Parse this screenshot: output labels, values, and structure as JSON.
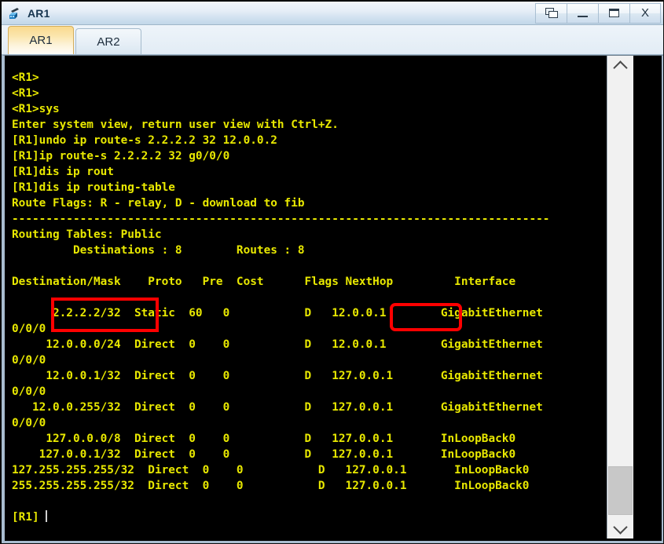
{
  "window": {
    "title": "AR1",
    "icon": "router-icon",
    "controls": [
      {
        "name": "restore-button",
        "icon": "restore-icon",
        "label": ""
      },
      {
        "name": "minimize-button",
        "icon": "minimize-icon",
        "label": ""
      },
      {
        "name": "maximize-button",
        "icon": "maximize-icon",
        "label": ""
      },
      {
        "name": "close-button",
        "icon": "close-icon",
        "label": "X"
      }
    ]
  },
  "tabs": [
    {
      "label": "AR1",
      "active": true
    },
    {
      "label": "AR2",
      "active": false
    }
  ],
  "terminal": {
    "colors": {
      "background": "#000000",
      "foreground": "#e8e800",
      "annotation": "#ff0000"
    },
    "lines": [
      "<R1>",
      "<R1>",
      "<R1>sys",
      "Enter system view, return user view with Ctrl+Z.",
      "[R1]undo ip route-s 2.2.2.2 32 12.0.0.2",
      "[R1]ip route-s 2.2.2.2 32 g0/0/0",
      "[R1]dis ip rout",
      "[R1]dis ip routing-table",
      "Route Flags: R - relay, D - download to fib",
      "-------------------------------------------------------------------------------",
      "Routing Tables: Public",
      "         Destinations : 8        Routes : 8",
      "",
      "Destination/Mask    Proto   Pre  Cost      Flags NextHop         Interface",
      "",
      "      2.2.2.2/32  Static  60   0           D   12.0.0.1        GigabitEthernet",
      "0/0/0",
      "     12.0.0.0/24  Direct  0    0           D   12.0.0.1        GigabitEthernet",
      "0/0/0",
      "     12.0.0.1/32  Direct  0    0           D   127.0.0.1       GigabitEthernet",
      "0/0/0",
      "   12.0.0.255/32  Direct  0    0           D   127.0.0.1       GigabitEthernet",
      "0/0/0",
      "     127.0.0.0/8  Direct  0    0           D   127.0.0.1       InLoopBack0",
      "    127.0.0.1/32  Direct  0    0           D   127.0.0.1       InLoopBack0",
      "127.255.255.255/32  Direct  0    0           D   127.0.0.1       InLoopBack0",
      "255.255.255.255/32  Direct  0    0           D   127.0.0.1       InLoopBack0",
      "",
      "[R1] "
    ]
  },
  "routing_table": {
    "flags_legend": "Route Flags: R - relay, D - download to fib",
    "table_name": "Routing Tables: Public",
    "destinations": "8",
    "routes": "8",
    "columns": [
      "Destination/Mask",
      "Proto",
      "Pre",
      "Cost",
      "Flags",
      "NextHop",
      "Interface"
    ],
    "rows": [
      {
        "destination": "2.2.2.2/32",
        "proto": "Static",
        "pre": "60",
        "cost": "0",
        "flags": "D",
        "nexthop": "12.0.0.1",
        "interface": "GigabitEthernet0/0/0",
        "highlighted": true
      },
      {
        "destination": "12.0.0.0/24",
        "proto": "Direct",
        "pre": "0",
        "cost": "0",
        "flags": "D",
        "nexthop": "12.0.0.1",
        "interface": "GigabitEthernet0/0/0",
        "highlighted": false
      },
      {
        "destination": "12.0.0.1/32",
        "proto": "Direct",
        "pre": "0",
        "cost": "0",
        "flags": "D",
        "nexthop": "127.0.0.1",
        "interface": "GigabitEthernet0/0/0",
        "highlighted": false
      },
      {
        "destination": "12.0.0.255/32",
        "proto": "Direct",
        "pre": "0",
        "cost": "0",
        "flags": "D",
        "nexthop": "127.0.0.1",
        "interface": "GigabitEthernet0/0/0",
        "highlighted": false
      },
      {
        "destination": "127.0.0.0/8",
        "proto": "Direct",
        "pre": "0",
        "cost": "0",
        "flags": "D",
        "nexthop": "127.0.0.1",
        "interface": "InLoopBack0",
        "highlighted": false
      },
      {
        "destination": "127.0.0.1/32",
        "proto": "Direct",
        "pre": "0",
        "cost": "0",
        "flags": "D",
        "nexthop": "127.0.0.1",
        "interface": "InLoopBack0",
        "highlighted": false
      },
      {
        "destination": "127.255.255.255/32",
        "proto": "Direct",
        "pre": "0",
        "cost": "0",
        "flags": "D",
        "nexthop": "127.0.0.1",
        "interface": "InLoopBack0",
        "highlighted": false
      },
      {
        "destination": "255.255.255.255/32",
        "proto": "Direct",
        "pre": "0",
        "cost": "0",
        "flags": "D",
        "nexthop": "127.0.0.1",
        "interface": "InLoopBack0",
        "highlighted": false
      }
    ]
  },
  "prompt": {
    "text": "[R1]"
  },
  "scrollbar": {
    "up_icon": "chevron-up-icon",
    "down_icon": "chevron-down-icon"
  }
}
